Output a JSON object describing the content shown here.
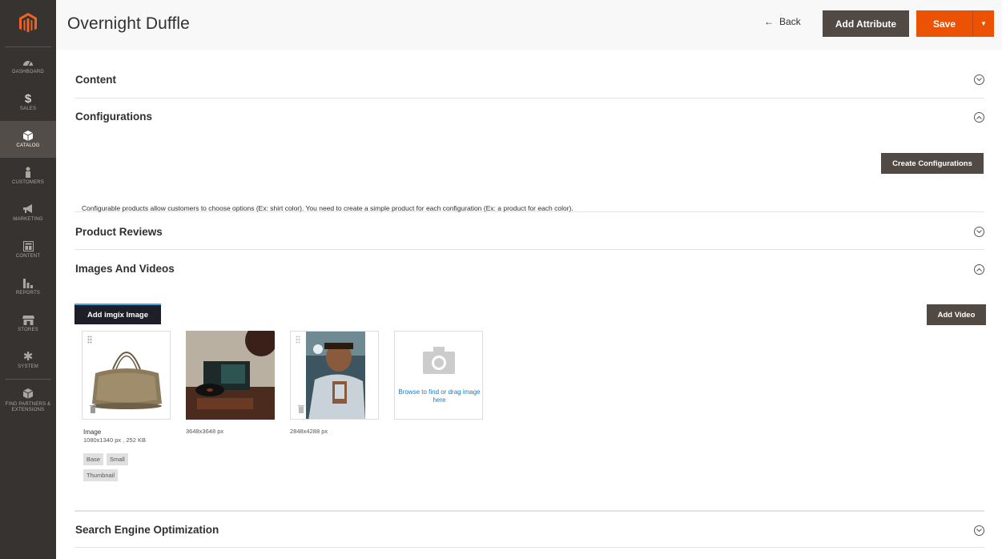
{
  "sidebar": {
    "items": [
      {
        "label": "Dashboard",
        "icon": "dashboard-icon"
      },
      {
        "label": "Sales",
        "icon": "dollar-icon"
      },
      {
        "label": "Catalog",
        "icon": "cube-icon",
        "active": true
      },
      {
        "label": "Customers",
        "icon": "person-icon"
      },
      {
        "label": "Marketing",
        "icon": "megaphone-icon"
      },
      {
        "label": "Content",
        "icon": "layout-icon"
      },
      {
        "label": "Reports",
        "icon": "bar-chart-icon"
      },
      {
        "label": "Stores",
        "icon": "store-icon"
      },
      {
        "label": "System",
        "icon": "gear-icon"
      },
      {
        "label": "Find Partners & Extensions",
        "icon": "box-icon"
      }
    ]
  },
  "header": {
    "title": "Overnight Duffle",
    "back_label": "Back",
    "add_attribute_label": "Add Attribute",
    "save_label": "Save"
  },
  "sections": {
    "content": "Content",
    "configurations": "Configurations",
    "product_reviews": "Product Reviews",
    "images_and_videos": "Images And Videos",
    "seo": "Search Engine Optimization"
  },
  "configurations": {
    "description": "Configurable products allow customers to choose options (Ex: shirt color). You need to create a simple product for each configuration (Ex: a product for each color).",
    "create_button": "Create Configurations"
  },
  "images": {
    "add_imgix_label": "Add imgix Image",
    "add_video_label": "Add Video",
    "items": [
      {
        "title": "Image",
        "meta": "1080x1340 px , 252 KB",
        "roles": [
          "Base",
          "Small",
          "Thumbnail"
        ]
      },
      {
        "title": "",
        "meta": "3648x3648 px",
        "roles": []
      },
      {
        "title": "",
        "meta": "2848x4288 px",
        "roles": []
      }
    ],
    "upload_text": "Browse to find or drag image here"
  },
  "colors": {
    "sidebar_bg": "#373330",
    "accent_orange": "#eb5202",
    "dark_button": "#514943",
    "link_blue": "#1979c3"
  }
}
